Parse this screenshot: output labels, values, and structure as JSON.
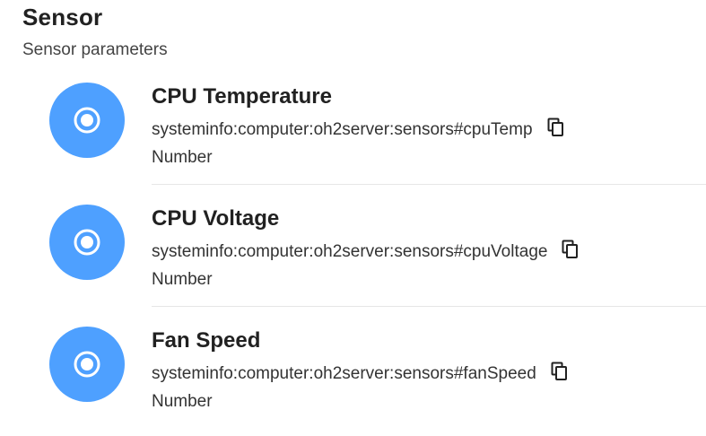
{
  "header": {
    "title": "Sensor",
    "subtitle": "Sensor parameters"
  },
  "items": [
    {
      "label": "CPU Temperature",
      "uid": "systeminfo:computer:oh2server:sensors#cpuTemp",
      "type": "Number",
      "icon": "radio-button-checked-icon",
      "icon_color": "#4ea0ff"
    },
    {
      "label": "CPU Voltage",
      "uid": "systeminfo:computer:oh2server:sensors#cpuVoltage",
      "type": "Number",
      "icon": "radio-button-checked-icon",
      "icon_color": "#4ea0ff"
    },
    {
      "label": "Fan Speed",
      "uid": "systeminfo:computer:oh2server:sensors#fanSpeed",
      "type": "Number",
      "icon": "radio-button-checked-icon",
      "icon_color": "#4ea0ff"
    }
  ],
  "copy_icon": "copy-icon"
}
